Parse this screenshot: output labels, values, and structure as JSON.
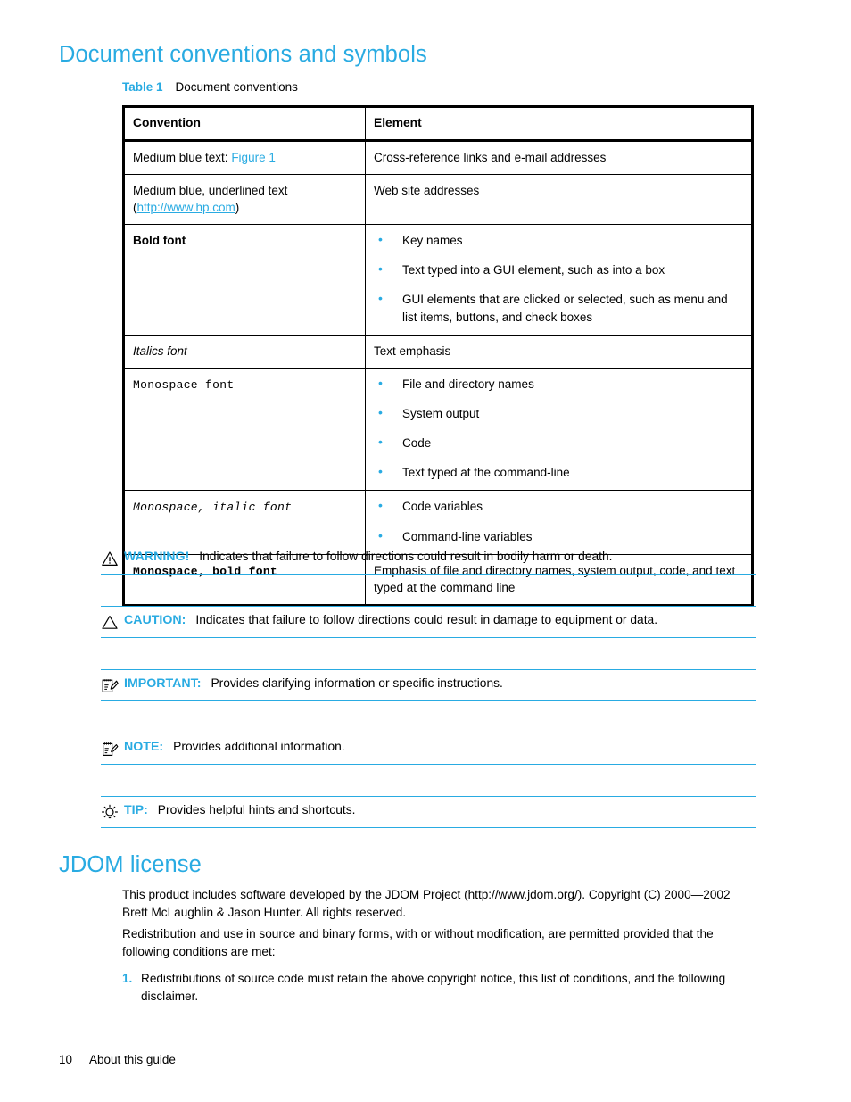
{
  "colors": {
    "accent": "#29abe2",
    "text": "#000000",
    "background": "#ffffff",
    "table_border": "#000000"
  },
  "headings": {
    "conventions": "Document conventions and symbols",
    "jdom": "JDOM license"
  },
  "table_caption": {
    "label": "Table 1",
    "text": "Document conventions"
  },
  "table": {
    "headers": {
      "convention": "Convention",
      "element": "Element"
    },
    "rows": [
      {
        "convention_prefix": "Medium blue text: ",
        "convention_link": "Figure 1",
        "element": "Cross-reference links and e-mail addresses"
      },
      {
        "convention_line1": "Medium blue, underlined text",
        "convention_paren_open": "(",
        "convention_url": "http://www.hp.com",
        "convention_paren_close": ")",
        "element": "Web site addresses"
      },
      {
        "convention": "Bold font",
        "element_bullets": [
          "Key names",
          "Text typed into a GUI element, such as into a box",
          "GUI elements that are clicked or selected, such as menu and list items, buttons, and check boxes"
        ]
      },
      {
        "convention": "Italics font",
        "element": "Text emphasis"
      },
      {
        "convention": "Monospace font",
        "element_bullets": [
          "File and directory names",
          "System output",
          "Code",
          "Text typed at the command-line"
        ]
      },
      {
        "convention": "Monospace, italic font",
        "element_bullets": [
          "Code variables",
          "Command-line variables"
        ]
      },
      {
        "convention": "Monospace, bold font",
        "element": "Emphasis of file and directory names, system output, code, and text typed at the command line"
      }
    ]
  },
  "notices": [
    {
      "icon": "warning-triangle-icon",
      "label": "WARNING!",
      "text": "Indicates that failure to follow directions could result in bodily harm or death."
    },
    {
      "icon": "caution-triangle-icon",
      "label": "CAUTION:",
      "text": "Indicates that failure to follow directions could result in damage to equipment or data."
    },
    {
      "icon": "important-notepad-pencil-icon",
      "label": "IMPORTANT:",
      "text": "Provides clarifying information or specific instructions."
    },
    {
      "icon": "note-notepad-icon",
      "label": "NOTE:",
      "text": "Provides additional information."
    },
    {
      "icon": "tip-lightbulb-icon",
      "label": "TIP:",
      "text": "Provides helpful hints and shortcuts."
    }
  ],
  "jdom": {
    "paragraph1": "This product includes software developed by the JDOM Project (http://www.jdom.org/). Copyright (C) 2000—2002 Brett McLaughlin & Jason Hunter. All rights reserved.",
    "paragraph2": "Redistribution and use in source and binary forms, with or without modification, are permitted provided that the following conditions are met:",
    "item1_number": "1.",
    "item1_text": "Redistributions of source code must retain the above copyright notice, this list of conditions, and the following disclaimer."
  },
  "footer": {
    "page_number": "10",
    "section": "About this guide"
  }
}
